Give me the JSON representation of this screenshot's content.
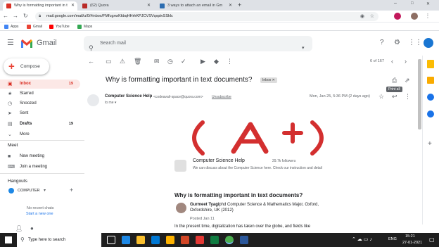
{
  "browser": {
    "tabs": [
      {
        "title": "Why is formatting important in t",
        "active": true
      },
      {
        "title": "(62) Quora",
        "active": false
      },
      {
        "title": "3 ways to attach an email in Gm",
        "active": false
      }
    ],
    "new_tab": "+",
    "url": "mail.google.com/mail/u/0/#inbox/FMfcgxwKkbqHHrhKPJCVSVqxptvSSklc",
    "bookmarks": [
      "Apps",
      "Gmail",
      "YouTube",
      "Maps"
    ],
    "window_controls": {
      "minimize": "–",
      "maximize": "□",
      "close": "✕"
    }
  },
  "gmail": {
    "logo_text": "Gmail",
    "search_placeholder": "Search mail",
    "compose_label": "Compose",
    "nav": [
      {
        "label": "Inbox",
        "count": "19",
        "icon": "inbox-icon",
        "selected": true
      },
      {
        "label": "Starred",
        "count": "",
        "icon": "star-icon",
        "selected": false
      },
      {
        "label": "Snoozed",
        "count": "",
        "icon": "clock-icon",
        "selected": false
      },
      {
        "label": "Sent",
        "count": "",
        "icon": "send-icon",
        "selected": false
      },
      {
        "label": "Drafts",
        "count": "19",
        "icon": "draft-icon",
        "selected": false
      },
      {
        "label": "More",
        "count": "",
        "icon": "chevron-down-icon",
        "selected": false
      }
    ],
    "meet": {
      "header": "Meet",
      "new_meeting": "New meeting",
      "join_meeting": "Join a meeting"
    },
    "hangouts": {
      "header": "Hangouts",
      "user": "COMPUTER",
      "no_chats": "No recent chats",
      "start_new": "Start a new one"
    },
    "pagination": "6 of 167",
    "tooltip": "Print all",
    "email": {
      "subject": "Why is formatting important in text documents?",
      "label_chip": "Inbox",
      "sender_name": "Computer Science Help",
      "sender_email": "<codeavail-space@quora.com>",
      "unsubscribe": "Unsubscribe",
      "to": "to me",
      "date": "Mon, Jan 25, 5:36 PM (2 days ago)",
      "space_name": "Computer Science Help",
      "space_followers": "29.7k followers",
      "space_desc": "We can discuss about the Computer Science here. Check our instruction and detail",
      "question": "Why is formatting important in text documents?",
      "author_name": "Gurmeet Tyagi",
      "author_creds_1": ", phd Computer Science & Mathematics Major, Oxford,",
      "author_creds_2": "Oxfordshire, UK (2012)",
      "posted": "Posted Jan 11",
      "body_text": "In the present time, digitalization has taken over the globe, and fields like",
      "banner_text": "(A+)"
    }
  },
  "taskbar": {
    "search_placeholder": "Type here to search",
    "time": "15:21",
    "date": "27-01-2021",
    "lang": "ENG"
  },
  "colors": {
    "gmail_red": "#d93025",
    "link_blue": "#1a73e8",
    "selected_bg": "#fce8e6"
  }
}
